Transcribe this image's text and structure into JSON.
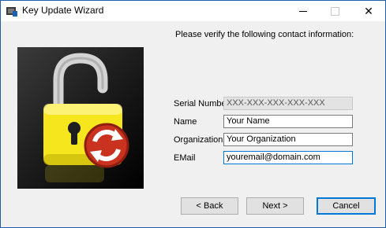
{
  "window": {
    "title": "Key Update Wizard"
  },
  "main": {
    "prompt": "Please verify the following contact information:"
  },
  "fields": {
    "serial": {
      "label": "Serial Number",
      "value": "XXX-XXX-XXX-XXX-XXX"
    },
    "name": {
      "label": "Name",
      "value": "Your Name"
    },
    "organization": {
      "label": "Organization",
      "value": "Your Organization"
    },
    "email": {
      "label": "EMail",
      "value": "youremail@domain.com"
    }
  },
  "buttons": {
    "back": "< Back",
    "next": "Next >",
    "cancel": "Cancel"
  },
  "colors": {
    "lock_body": "#f5e61e",
    "refresh_badge": "#c8321e",
    "focus_border": "#0078d7"
  }
}
